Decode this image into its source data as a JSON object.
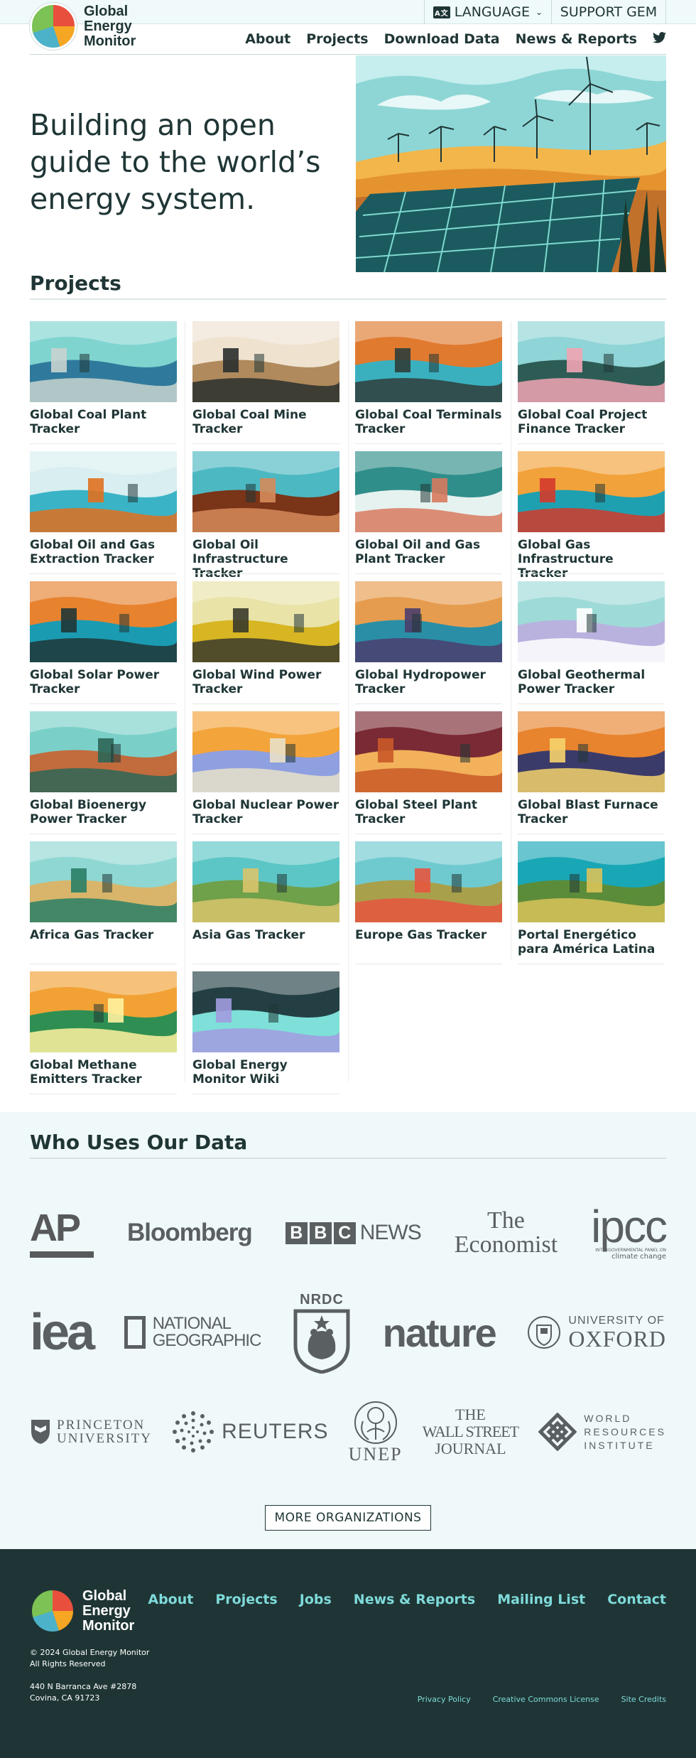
{
  "header": {
    "language_label": "LANGUAGE",
    "support_label": "SUPPORT GEM",
    "logo_line1": "Global",
    "logo_line2": "Energy",
    "logo_line3": "Monitor",
    "nav": [
      "About",
      "Projects",
      "Download Data",
      "News & Reports"
    ],
    "twitter_icon": "twitter-icon"
  },
  "hero": {
    "title": "Building an open guide to the world’s energy system."
  },
  "projects": {
    "title": "Projects",
    "items": [
      {
        "name": "Global Coal Plant Tracker",
        "sky": "#7fd4d0",
        "ground": "#2f7a9c",
        "accent": "#c8d3cf"
      },
      {
        "name": "Global Coal Mine Tracker",
        "sky": "#efe2cf",
        "ground": "#b08a5c",
        "accent": "#2a2f2d"
      },
      {
        "name": "Global Coal Terminals Tracker",
        "sky": "#e07a2f",
        "ground": "#3ab0bf",
        "accent": "#2f3e3a"
      },
      {
        "name": "Global Coal Project Finance Tracker",
        "sky": "#8fd4d6",
        "ground": "#2d5c55",
        "accent": "#f2a4b4"
      },
      {
        "name": "Global Oil and Gas Extraction Tracker",
        "sky": "#d8eef0",
        "ground": "#3bb3c6",
        "accent": "#e0701f"
      },
      {
        "name": "Global Oil Infrastructure Tracker",
        "sky": "#4cb8c2",
        "ground": "#7a3418",
        "accent": "#d68b5a"
      },
      {
        "name": "Global Oil and Gas Plant Tracker",
        "sky": "#2f8e8a",
        "ground": "#e6f2f0",
        "accent": "#d77a5e"
      },
      {
        "name": "Global Gas Infrastructure Tracker",
        "sky": "#f2a23a",
        "ground": "#1fa0b0",
        "accent": "#d43a2c"
      },
      {
        "name": "Global Solar Power Tracker",
        "sky": "#e7822e",
        "ground": "#1a9bb2",
        "accent": "#203636"
      },
      {
        "name": "Global Wind Power Tracker",
        "sky": "#e9e3a8",
        "ground": "#d7b523",
        "accent": "#3a3a2a"
      },
      {
        "name": "Global Hydropower Tracker",
        "sky": "#e69c4e",
        "ground": "#2a8fa6",
        "accent": "#4a3e6e"
      },
      {
        "name": "Global Geothermal Power Tracker",
        "sky": "#9edbd8",
        "ground": "#b9b2df",
        "accent": "#ffffff"
      },
      {
        "name": "Global Bioenergy Power Tracker",
        "sky": "#7ad0c8",
        "ground": "#c26b3d",
        "accent": "#2d6656"
      },
      {
        "name": "Global Nuclear Power Tracker",
        "sky": "#f3a43b",
        "ground": "#8fa0e0",
        "accent": "#e8e0c9"
      },
      {
        "name": "Global Steel Plant Tracker",
        "sky": "#7a2a34",
        "ground": "#f2b15a",
        "accent": "#c95a28"
      },
      {
        "name": "Global Blast Furnace Tracker",
        "sky": "#e8842e",
        "ground": "#3b3b6a",
        "accent": "#f6d36b"
      },
      {
        "name": "Africa Gas Tracker",
        "sky": "#8fd7d3",
        "ground": "#d8b56a",
        "accent": "#2a7f66"
      },
      {
        "name": "Asia Gas Tracker",
        "sky": "#5cc6c6",
        "ground": "#6fa04a",
        "accent": "#d8c46b"
      },
      {
        "name": "Europe Gas Tracker",
        "sky": "#6fcad0",
        "ground": "#a9a04c",
        "accent": "#e6553f"
      },
      {
        "name": "Portal Energético para América Latina",
        "sky": "#19a7b6",
        "ground": "#5b8c3a",
        "accent": "#d9c35a"
      },
      {
        "name": "Global Methane Emitters Tracker",
        "sky": "#f2a235",
        "ground": "#2f8f52",
        "accent": "#fff2a0"
      },
      {
        "name": "Global Energy Monitor Wiki",
        "sky": "#233f44",
        "ground": "#7ee0d8",
        "accent": "#a29be0"
      }
    ]
  },
  "who_uses": {
    "title": "Who Uses Our Data",
    "orgs": {
      "ap": "AP",
      "bloomberg": "Bloomberg",
      "bbc_boxes": [
        "B",
        "B",
        "C"
      ],
      "bbc_news": "NEWS",
      "economist_1": "The",
      "economist_2": "Economist",
      "ipcc": "ipcc",
      "ipcc_sub1": "INTERGOVERNMENTAL PANEL ON",
      "ipcc_sub2": "climate change",
      "iea": "iea",
      "natgeo_1": "NATIONAL",
      "natgeo_2": "GEOGRAPHIC",
      "nrdc": "NRDC",
      "nature": "nature",
      "oxford_1": "UNIVERSITY OF",
      "oxford_2": "OXFORD",
      "princeton_1": "PRINCETON",
      "princeton_2": "UNIVERSITY",
      "reuters": "REUTERS",
      "unep": "UNEP",
      "wsj_1": "THE",
      "wsj_2": "WALL STREET",
      "wsj_3": "JOURNAL",
      "wri_1": "WORLD",
      "wri_2": "RESOURCES",
      "wri_3": "INSTITUTE"
    },
    "more_label": "MORE ORGANIZATIONS"
  },
  "footer": {
    "logo_line1": "Global",
    "logo_line2": "Energy",
    "logo_line3": "Monitor",
    "copyright": "© 2024 Global Energy Monitor",
    "rights": "All Rights Reserved",
    "address_1": "440 N Barranca Ave #2878",
    "address_2": "Covina, CA 91723",
    "nav": [
      "About",
      "Projects",
      "Jobs",
      "News & Reports",
      "Mailing List",
      "Contact"
    ],
    "legal": [
      "Privacy Policy",
      "Creative Commons License",
      "Site Credits"
    ]
  },
  "colors": {
    "ink": "#203636",
    "footer_bg": "#1f3535",
    "footer_link": "#7fdada",
    "who_bg": "#f0f9f9"
  }
}
